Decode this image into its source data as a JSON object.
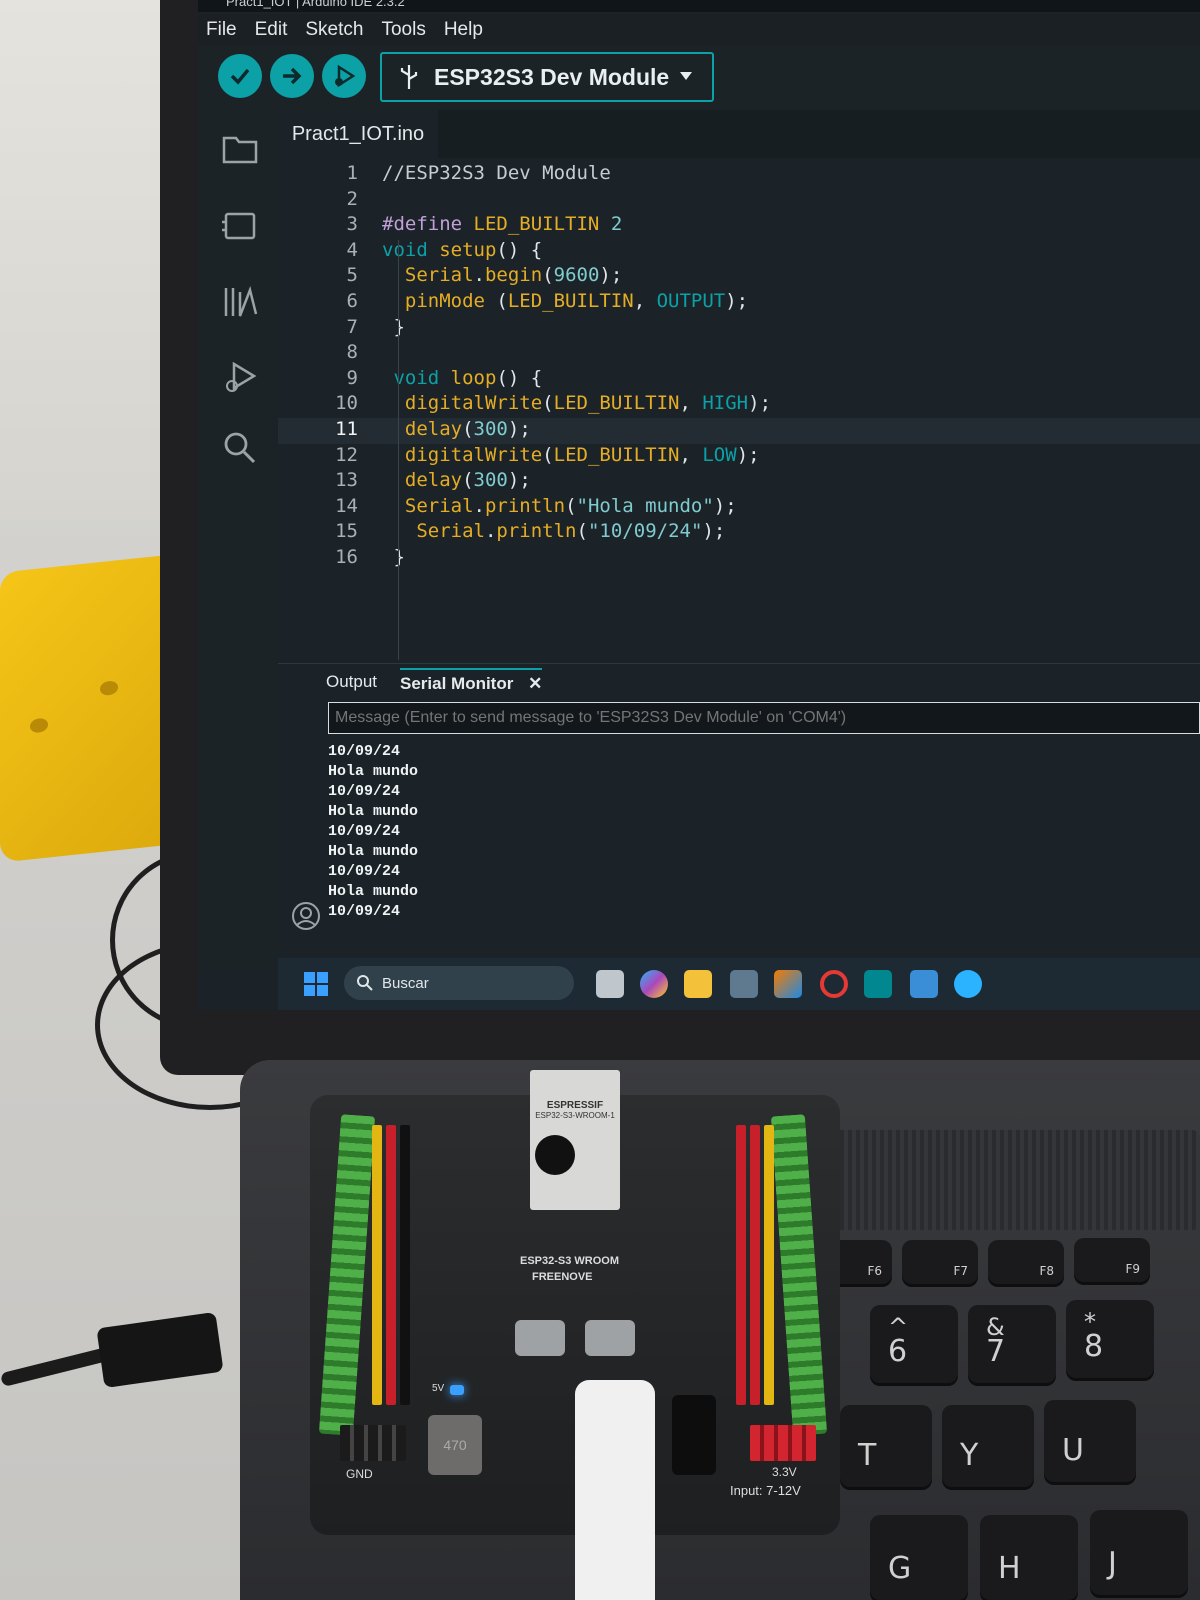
{
  "window": {
    "title": "Pract1_IOT | Arduino IDE 2.3.2"
  },
  "menu": [
    "File",
    "Edit",
    "Sketch",
    "Tools",
    "Help"
  ],
  "toolbar": {
    "verify_icon": "check-icon",
    "upload_icon": "arrow-right-icon",
    "debug_icon": "debug-icon",
    "board_name": "ESP32S3 Dev Module"
  },
  "editor": {
    "tab_label": "Pract1_IOT.ino",
    "active_line": 11,
    "lines": [
      {
        "n": "1",
        "text": "//ESP32S3 Dev Module"
      },
      {
        "n": "2",
        "text": ""
      },
      {
        "n": "3",
        "text": "#define LED_BUILTIN 2"
      },
      {
        "n": "4",
        "text": "void setup() {"
      },
      {
        "n": "5",
        "text": "  Serial.begin(9600);"
      },
      {
        "n": "6",
        "text": "  pinMode (LED_BUILTIN, OUTPUT);"
      },
      {
        "n": "7",
        "text": " }"
      },
      {
        "n": "8",
        "text": ""
      },
      {
        "n": "9",
        "text": " void loop() {"
      },
      {
        "n": "10",
        "text": "  digitalWrite(LED_BUILTIN, HIGH);"
      },
      {
        "n": "11",
        "text": "  delay(300);"
      },
      {
        "n": "12",
        "text": "  digitalWrite(LED_BUILTIN, LOW);"
      },
      {
        "n": "13",
        "text": "  delay(300);"
      },
      {
        "n": "14",
        "text": "  Serial.println(\"Hola mundo\");"
      },
      {
        "n": "15",
        "text": "   Serial.println(\"10/09/24\");"
      },
      {
        "n": "16",
        "text": " }"
      }
    ]
  },
  "panel": {
    "output_tab": "Output",
    "serial_tab": "Serial Monitor",
    "close_glyph": "✕",
    "message_placeholder": "Message (Enter to send message to 'ESP32S3 Dev Module' on 'COM4')",
    "serial_lines": [
      "10/09/24",
      "Hola mundo",
      "10/09/24",
      "Hola mundo",
      "10/09/24",
      "Hola mundo",
      "10/09/24",
      "Hola mundo",
      "10/09/24"
    ]
  },
  "taskbar": {
    "search_label": "Buscar"
  },
  "keyboard": {
    "keys": [
      {
        "main": "6",
        "top": "^",
        "fn": ""
      },
      {
        "main": "7",
        "top": "&",
        "fn": ""
      },
      {
        "main": "8",
        "top": "*",
        "fn": ""
      },
      {
        "main": "T",
        "top": "",
        "fn": ""
      },
      {
        "main": "Y",
        "top": "",
        "fn": ""
      },
      {
        "main": "U",
        "top": "",
        "fn": ""
      },
      {
        "main": "G",
        "top": "",
        "fn": ""
      },
      {
        "main": "H",
        "top": "",
        "fn": ""
      },
      {
        "main": "J",
        "top": "",
        "fn": ""
      },
      {
        "main": "",
        "top": "",
        "fn": "F6"
      },
      {
        "main": "",
        "top": "",
        "fn": "F7"
      },
      {
        "main": "",
        "top": "",
        "fn": "F8"
      },
      {
        "main": "",
        "top": "",
        "fn": "F9"
      }
    ]
  },
  "board": {
    "module_brand": "ESPRESSIF",
    "module_model": "ESP32-S3-WROOM-1",
    "board_label": "ESP32-S3 WROOM",
    "maker": "FREENOVE",
    "power_label": "Input: 7-12V",
    "voltage_label": "3.3V",
    "gnd_label": "GND",
    "fivev_label": "5V",
    "inductor": "470"
  },
  "colors": {
    "accent": "#0ca1a6",
    "editor_bg": "#1b2329",
    "keyword": "#0ca1a6",
    "function": "#e5ad24"
  }
}
